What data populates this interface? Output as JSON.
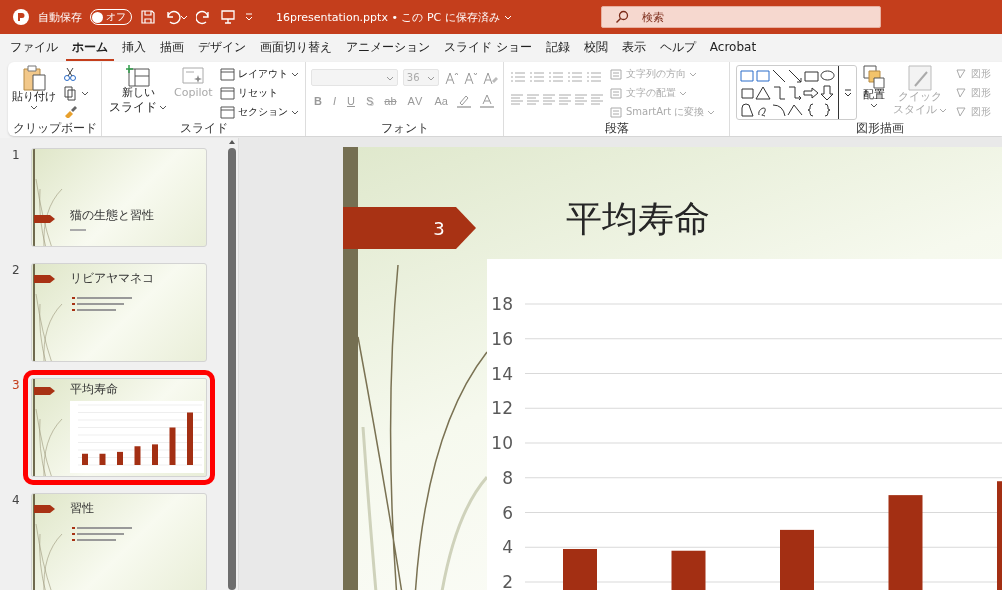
{
  "titlebar": {
    "autosave_label": "自動保存",
    "autosave": {
      "on": false,
      "label": "オフ"
    },
    "file_title": "16presentation.pptx • この PC に保存済み",
    "search": {
      "placeholder": "検索"
    }
  },
  "tabs": [
    {
      "label": "ファイル",
      "selected": false
    },
    {
      "label": "ホーム",
      "selected": true
    },
    {
      "label": "挿入",
      "selected": false
    },
    {
      "label": "描画",
      "selected": false
    },
    {
      "label": "デザイン",
      "selected": false
    },
    {
      "label": "画面切り替え",
      "selected": false
    },
    {
      "label": "アニメーション",
      "selected": false
    },
    {
      "label": "スライド ショー",
      "selected": false
    },
    {
      "label": "記録",
      "selected": false
    },
    {
      "label": "校閲",
      "selected": false
    },
    {
      "label": "表示",
      "selected": false
    },
    {
      "label": "ヘルプ",
      "selected": false
    },
    {
      "label": "Acrobat",
      "selected": false
    }
  ],
  "ribbon": {
    "clipboard": {
      "paste": "貼り付け",
      "label": "クリップボード"
    },
    "slides": {
      "new_slide": [
        "新しい",
        "スライド"
      ],
      "copilot": {
        "label": "Copilot",
        "disabled": true
      },
      "items": [
        "レイアウト",
        "リセット",
        "セクション"
      ],
      "label": "スライド"
    },
    "font": {
      "disabled": true,
      "font_size": "36",
      "format_buttons": [
        {
          "kind": "bold",
          "label": "B"
        },
        {
          "kind": "italic",
          "label": "I"
        },
        {
          "kind": "underline",
          "label": "U"
        },
        {
          "kind": "shadow",
          "label": "S"
        },
        {
          "kind": "strike",
          "label": "ab"
        },
        {
          "kind": "spacing",
          "label": "AV"
        },
        {
          "kind": "case",
          "label": "Aa"
        }
      ],
      "label": "フォント"
    },
    "paragraph": {
      "disabled": true,
      "items": [
        "文字列の方向",
        "文字の配置",
        "SmartArt に変換"
      ],
      "label": "段落"
    },
    "drawing": {
      "arrange": {
        "label": "配置",
        "disabled": false
      },
      "quick_style": {
        "label": [
          "クイック",
          "スタイル"
        ],
        "disabled": true
      },
      "shape_items": [
        "図形",
        "図形",
        "図形"
      ],
      "label": "図形描画"
    }
  },
  "slides": [
    {
      "number": "1",
      "selected": false,
      "kind": "title",
      "title": "猫の生態と習性"
    },
    {
      "number": "2",
      "selected": false,
      "kind": "bullets",
      "title": "リビアヤマネコ"
    },
    {
      "number": "3",
      "selected": true,
      "kind": "chart",
      "title": "平均寿命"
    },
    {
      "number": "4",
      "selected": false,
      "kind": "bullets",
      "title": "習性"
    }
  ],
  "current_slide": {
    "tag": "3",
    "title": "平均寿命",
    "chart_data": {
      "type": "bar",
      "grid": true,
      "ylim": [
        0,
        18
      ],
      "yticks": [
        2,
        4,
        6,
        8,
        10,
        12,
        14,
        16,
        18
      ],
      "series": [
        {
          "color": "#a32f13",
          "values": [
            3.9,
            3.8,
            5,
            7,
            7.8
          ]
        }
      ]
    }
  }
}
